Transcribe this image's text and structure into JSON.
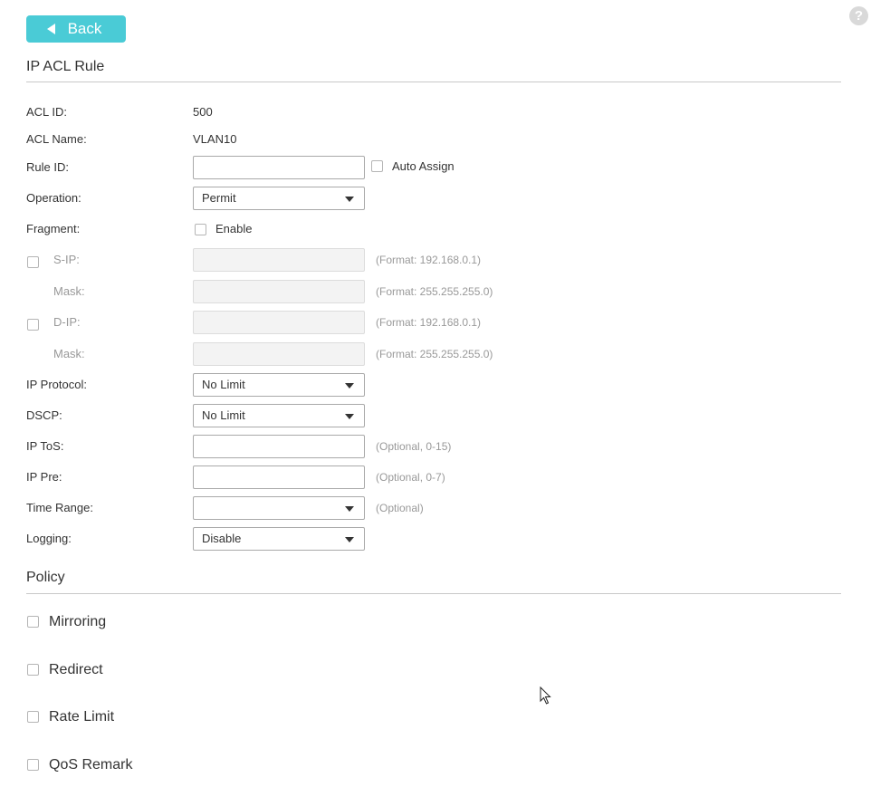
{
  "header": {
    "back_label": "Back",
    "help_glyph": "?"
  },
  "rule_section": {
    "title": "IP ACL Rule"
  },
  "fields": {
    "acl_id": {
      "label": "ACL ID:",
      "value": "500"
    },
    "acl_name": {
      "label": "ACL Name:",
      "value": "VLAN10"
    },
    "rule_id": {
      "label": "Rule ID:",
      "value": "",
      "auto_assign_label": "Auto Assign",
      "auto_assign_checked": false
    },
    "operation": {
      "label": "Operation:",
      "selected": "Permit"
    },
    "fragment": {
      "label": "Fragment:",
      "enable_label": "Enable",
      "checked": false
    },
    "s_ip": {
      "label": "S-IP:",
      "value": "",
      "hint": "(Format: 192.168.0.1)",
      "checked": false
    },
    "s_mask": {
      "label": "Mask:",
      "value": "",
      "hint": "(Format: 255.255.255.0)"
    },
    "d_ip": {
      "label": "D-IP:",
      "value": "",
      "hint": "(Format: 192.168.0.1)",
      "checked": false
    },
    "d_mask": {
      "label": "Mask:",
      "value": "",
      "hint": "(Format: 255.255.255.0)"
    },
    "ip_protocol": {
      "label": "IP Protocol:",
      "selected": "No Limit"
    },
    "dscp": {
      "label": "DSCP:",
      "selected": "No Limit"
    },
    "ip_tos": {
      "label": "IP ToS:",
      "value": "",
      "hint": "(Optional, 0-15)"
    },
    "ip_pre": {
      "label": "IP Pre:",
      "value": "",
      "hint": "(Optional, 0-7)"
    },
    "time_range": {
      "label": "Time Range:",
      "selected": "",
      "hint": "(Optional)"
    },
    "logging": {
      "label": "Logging:",
      "selected": "Disable"
    }
  },
  "policy_section": {
    "title": "Policy",
    "items": [
      {
        "label": "Mirroring",
        "checked": false
      },
      {
        "label": "Redirect",
        "checked": false
      },
      {
        "label": "Rate Limit",
        "checked": false
      },
      {
        "label": "QoS Remark",
        "checked": false
      }
    ]
  },
  "colors": {
    "accent": "#4acbd6",
    "text": "#333333",
    "hint": "#999999",
    "divider": "#c8c8c8"
  },
  "icons": {
    "back": "triangle-left-icon",
    "help": "help-icon",
    "dropdown": "caret-down-icon",
    "cursor": "mouse-pointer-icon"
  }
}
